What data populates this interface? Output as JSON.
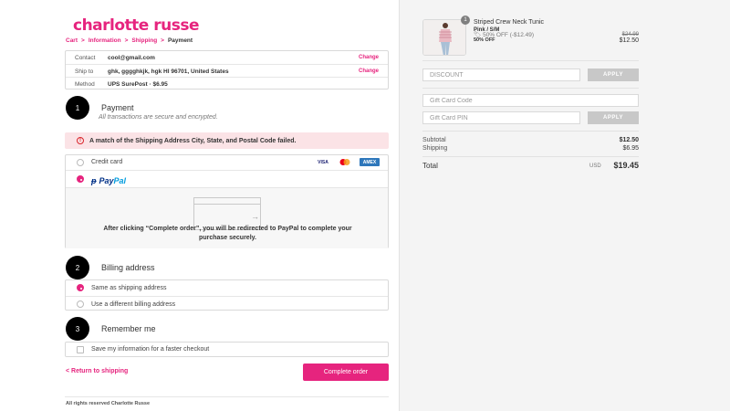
{
  "brand": {
    "logo_text": "charlotte russe",
    "color": "#e6247e"
  },
  "breadcrumb": {
    "cart": "Cart",
    "information": "Information",
    "shipping": "Shipping",
    "payment": "Payment",
    "sep": ">"
  },
  "review": {
    "contact_label": "Contact",
    "contact_value": "cool@gmail.com",
    "ship_label": "Ship to",
    "ship_value": "ghk, gggghkjk, hgk HI 96701, United States",
    "method_label": "Method",
    "method_value": "UPS SurePost · $6.95",
    "change": "Change"
  },
  "payment": {
    "num": "1",
    "title": "Payment",
    "subtitle": "All transactions are secure and encrypted.",
    "alert": "A match of the Shipping Address City, State, and Postal Code failed.",
    "alert_icon": "!",
    "credit_card": "Credit card",
    "cards": {
      "visa": "VISA",
      "amex": "AMEX"
    },
    "paypal_a": "Pay",
    "paypal_b": "Pal",
    "redirect_text": "After clicking “Complete order”, you will be redirected to PayPal to complete your purchase securely.",
    "arrow": "→"
  },
  "billing": {
    "num": "2",
    "title": "Billing address",
    "same": "Same as shipping address",
    "different": "Use a different billing address"
  },
  "remember": {
    "num": "3",
    "title": "Remember me",
    "save": "Save my information for a faster checkout"
  },
  "actions": {
    "back": "< Return to shipping",
    "complete": "Complete order"
  },
  "footer": "All rights reserved Charlotte Russe",
  "summary": {
    "item": {
      "qty": "1",
      "name": "Striped Crew Neck Tunic",
      "variant": "Pink / S/M",
      "discount": "50% OFF (-$12.49)",
      "discount2": "50% OFF",
      "orig_price": "$24.99",
      "price": "$12.50"
    },
    "discount_placeholder": "DISCOUNT",
    "apply": "APPLY",
    "gift_code_placeholder": "Gift Card Code",
    "gift_pin_placeholder": "Gift Card PIN",
    "subtotal_label": "Subtotal",
    "subtotal": "$12.50",
    "shipping_label": "Shipping",
    "shipping": "$6.95",
    "total_label": "Total",
    "currency": "USD",
    "total": "$19.45"
  }
}
